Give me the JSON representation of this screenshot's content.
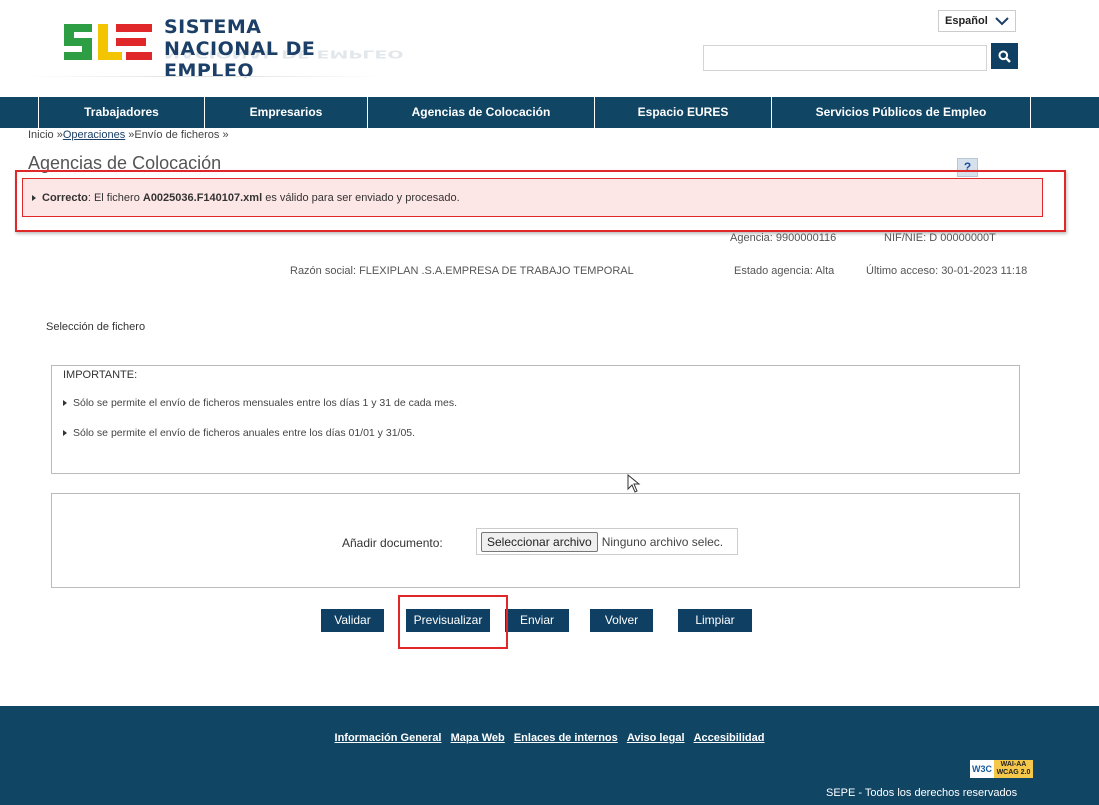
{
  "header": {
    "logo_line1": "SISTEMA",
    "logo_line2": "NACIONAL DE EMPLEO",
    "language": "Español",
    "search_placeholder": ""
  },
  "nav": [
    "Trabajadores",
    "Empresarios",
    "Agencias de Colocación",
    "Espacio EURES",
    "Servicios Públicos de Empleo"
  ],
  "breadcrumb": {
    "home": "Inicio »",
    "ops": "Operaciones",
    "current": " »Envío de ficheros »"
  },
  "page_title": "Agencias de Colocación",
  "help": "?",
  "alert": {
    "label": "Correcto",
    "prefix": ": El fichero ",
    "file": "A0025036.F140107.xml",
    "suffix": " es válido para ser enviado y procesado."
  },
  "agency": {
    "agencia": "Agencia: 9900000116",
    "nif": "NIF/NIE: D 00000000T",
    "razon": "Razón social: FLEXIPLAN .S.A.EMPRESA DE TRABAJO TEMPORAL",
    "estado": "Estado agencia: Alta",
    "acceso": "Último acceso: 30-01-2023 11:18"
  },
  "section_title": "Selección de fichero",
  "important": {
    "head": "IMPORTANTE:",
    "items": [
      "Sólo se permite el envío de ficheros mensuales entre los días 1 y 31 de cada mes.",
      "Sólo se permite el envío de ficheros anuales entre los días 01/01 y 31/05."
    ]
  },
  "upload": {
    "label": "Añadir documento:",
    "button": "Seleccionar archivo",
    "no_file": "Ninguno archivo selec."
  },
  "buttons": {
    "validar": "Validar",
    "previsualizar": "Previsualizar",
    "enviar": "Enviar",
    "volver": "Volver",
    "limpiar": "Limpiar"
  },
  "footer": {
    "links": [
      "Información General",
      "Mapa Web",
      "Enlaces de internos",
      "Aviso legal",
      "Accesibilidad"
    ],
    "w3c": "W3C",
    "wai_line1": "WAI-AA",
    "wai_line2": "WCAG 2.0",
    "copyright": "SEPE - Todos los derechos reservados"
  },
  "colors": {
    "navy": "#104564",
    "alert_border": "#e0282a",
    "alert_bg": "#fde6e6"
  }
}
